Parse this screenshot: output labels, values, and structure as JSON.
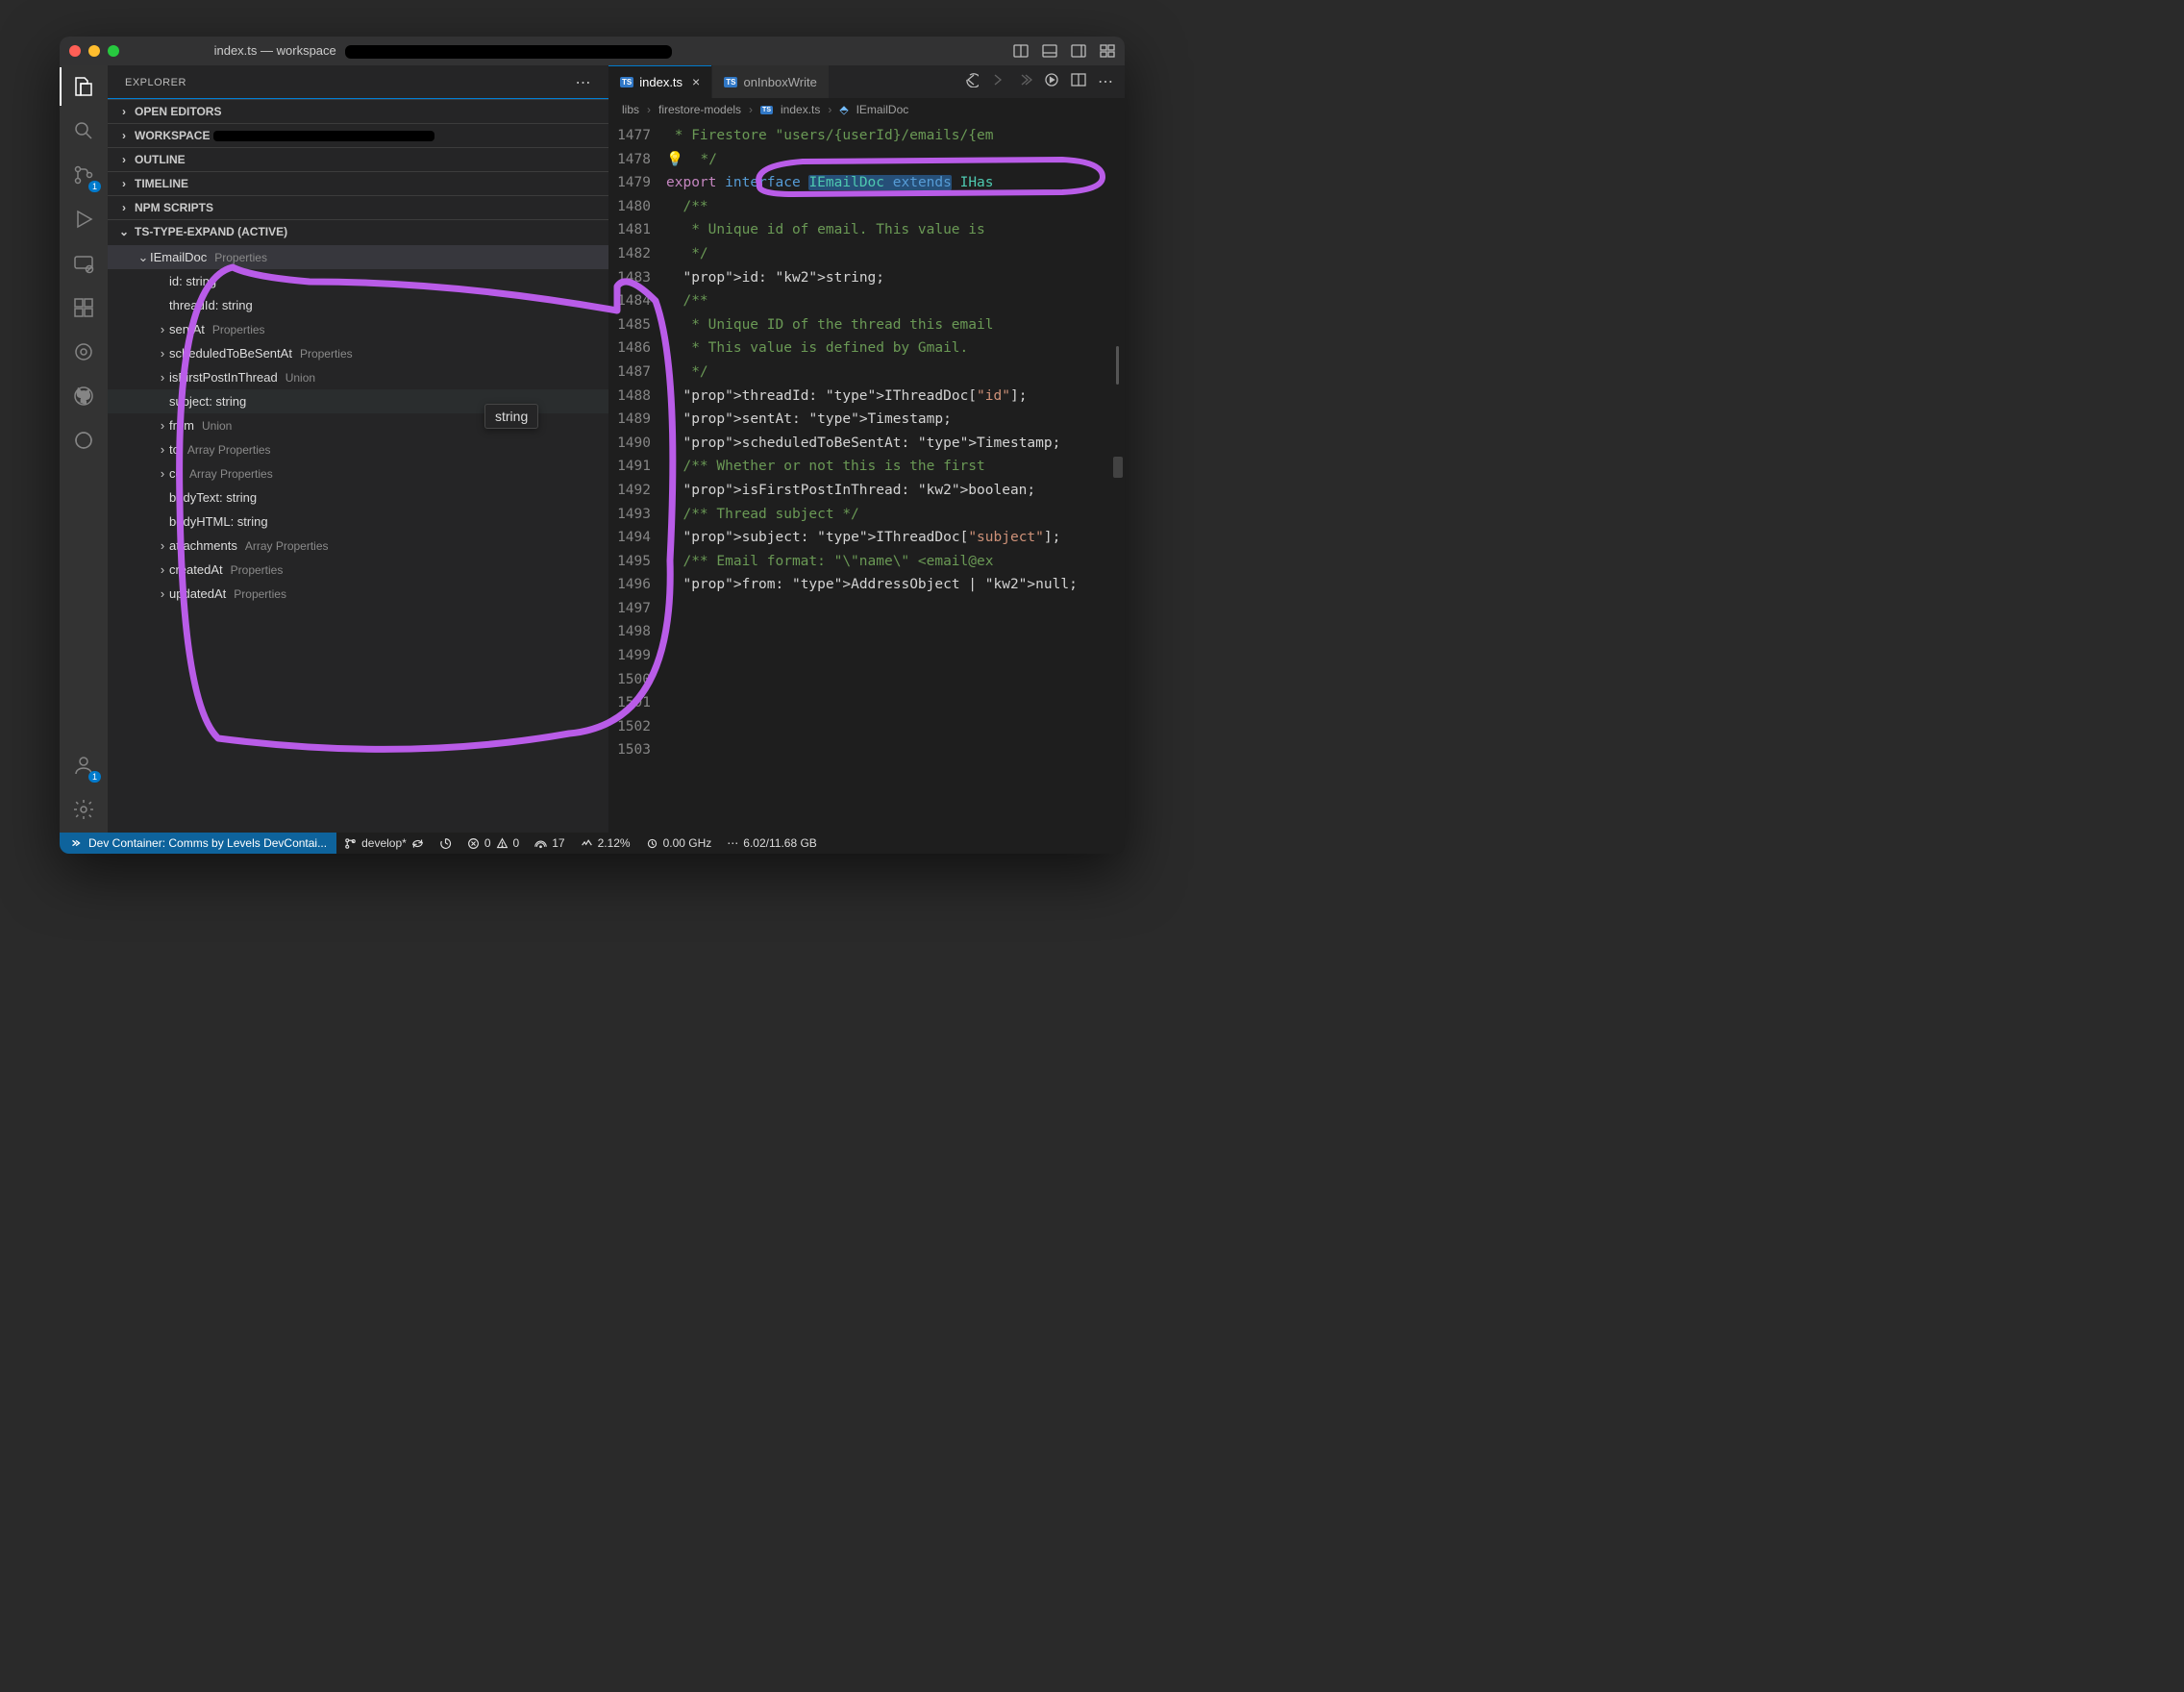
{
  "titlebar": {
    "title": "index.ts — workspace"
  },
  "sidebar": {
    "title": "EXPLORER",
    "panels": {
      "open_editors": "OPEN EDITORS",
      "workspace": "WORKSPACE",
      "outline": "OUTLINE",
      "timeline": "TIMELINE",
      "npm_scripts": "NPM SCRIPTS",
      "type_expand": "TS-TYPE-EXPAND (ACTIVE)"
    },
    "type_tree": {
      "root": {
        "name": "IEmailDoc",
        "badge": "Properties"
      },
      "items": [
        {
          "name": "id: string",
          "chevron": "",
          "badge": ""
        },
        {
          "name": "threadId: string",
          "chevron": "",
          "badge": ""
        },
        {
          "name": "sentAt",
          "chevron": ">",
          "badge": "Properties"
        },
        {
          "name": "scheduledToBeSentAt",
          "chevron": ">",
          "badge": "Properties"
        },
        {
          "name": "isFirstPostInThread",
          "chevron": ">",
          "badge": "Union"
        },
        {
          "name": "subject: string",
          "chevron": "",
          "badge": "",
          "hovered": true
        },
        {
          "name": "from",
          "chevron": ">",
          "badge": "Union"
        },
        {
          "name": "to",
          "chevron": ">",
          "badge": "Array Properties"
        },
        {
          "name": "cc",
          "chevron": ">",
          "badge": "Array Properties"
        },
        {
          "name": "bodyText: string",
          "chevron": "",
          "badge": ""
        },
        {
          "name": "bodyHTML: string",
          "chevron": "",
          "badge": ""
        },
        {
          "name": "attachments",
          "chevron": ">",
          "badge": "Array Properties"
        },
        {
          "name": "createdAt",
          "chevron": ">",
          "badge": "Properties"
        },
        {
          "name": "updatedAt",
          "chevron": ">",
          "badge": "Properties"
        }
      ],
      "tooltip": "string"
    }
  },
  "editor": {
    "tabs": [
      {
        "label": "index.ts",
        "active": true
      },
      {
        "label": "onInboxWrite",
        "active": false
      }
    ],
    "breadcrumb": [
      "libs",
      "firestore-models",
      "index.ts",
      "IEmailDoc"
    ],
    "line_start": 1477,
    "line_end": 1503,
    "lines": [
      " * Firestore \"users/{userId}/emails/{em",
      " */",
      "export interface IEmailDoc extends IHas",
      "  /**",
      "   * Unique id of email. This value is ",
      "   */",
      "  id: string;",
      "",
      "  /**",
      "   * Unique ID of the thread this email",
      "   * This value is defined by Gmail.",
      "   */",
      "  threadId: IThreadDoc[\"id\"];",
      "",
      "  sentAt: Timestamp;",
      "",
      "  scheduledToBeSentAt: Timestamp;",
      "",
      "  /** Whether or not this is the first ",
      "  isFirstPostInThread: boolean;",
      "",
      "  /** Thread subject */",
      "  subject: IThreadDoc[\"subject\"];",
      "",
      "  /** Email format: \"\\\"name\\\" <email@ex",
      "  from: AddressObject | null;",
      ""
    ]
  },
  "statusbar": {
    "remote": "Dev Container: Comms by Levels DevContai...",
    "branch": "develop*",
    "errors": "0",
    "warnings": "0",
    "port": "17",
    "cpu": "2.12%",
    "ghz": "0.00 GHz",
    "mem": "6.02/11.68 GB"
  },
  "activitybar": {
    "scm_badge": "1",
    "account_badge": "1"
  }
}
